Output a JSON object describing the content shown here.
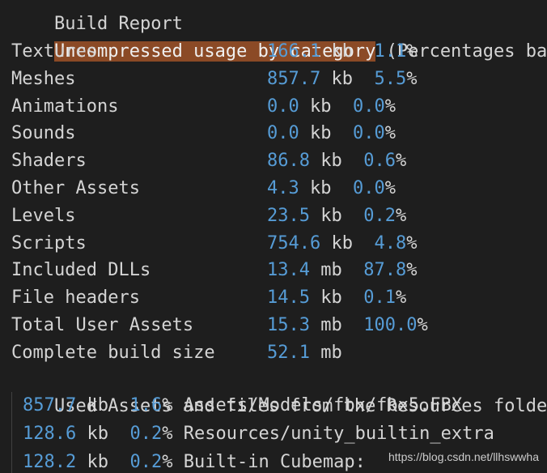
{
  "report": {
    "title_partial": "Build Report",
    "header": {
      "highlighted": "Uncompressed usage by category",
      "rest": " (Percentages based"
    },
    "rows": [
      {
        "label": "Textures",
        "size": "166.1",
        "unit": "kb",
        "pct": "1.1",
        "pct_sign": "%"
      },
      {
        "label": "Meshes",
        "size": "857.7",
        "unit": "kb",
        "pct": "5.5",
        "pct_sign": "%"
      },
      {
        "label": "Animations",
        "size": "0.0",
        "unit": "kb",
        "pct": "0.0",
        "pct_sign": "%"
      },
      {
        "label": "Sounds",
        "size": "0.0",
        "unit": "kb",
        "pct": "0.0",
        "pct_sign": "%"
      },
      {
        "label": "Shaders",
        "size": "86.8",
        "unit": "kb",
        "pct": "0.6",
        "pct_sign": "%"
      },
      {
        "label": "Other Assets",
        "size": "4.3",
        "unit": "kb",
        "pct": "0.0",
        "pct_sign": "%"
      },
      {
        "label": "Levels",
        "size": "23.5",
        "unit": "kb",
        "pct": "0.2",
        "pct_sign": "%"
      },
      {
        "label": "Scripts",
        "size": "754.6",
        "unit": "kb",
        "pct": "4.8",
        "pct_sign": "%"
      },
      {
        "label": "Included DLLs",
        "size": "13.4",
        "unit": "mb",
        "pct": "87.8",
        "pct_sign": "%"
      },
      {
        "label": "File headers",
        "size": "14.5",
        "unit": "kb",
        "pct": "0.1",
        "pct_sign": "%"
      },
      {
        "label": "Total User Assets",
        "size": "15.3",
        "unit": "mb",
        "pct": "100.0",
        "pct_sign": "%"
      },
      {
        "label": "Complete build size",
        "size": "52.1",
        "unit": "mb",
        "pct": "",
        "pct_sign": ""
      }
    ],
    "used_assets_header": "Used Assets and files from the Resources folder,",
    "assets": [
      {
        "size": "857.7",
        "unit": "kb",
        "pct": "1.6",
        "pct_sign": "%",
        "path": "Assets/Models/fbx/fbx5.FBX"
      },
      {
        "size": "128.6",
        "unit": "kb",
        "pct": "0.2",
        "pct_sign": "%",
        "path": "Resources/unity_builtin_extra"
      },
      {
        "size": "128.2",
        "unit": "kb",
        "pct": "0.2",
        "pct_sign": "%",
        "path": "Built-in Cubemap:"
      }
    ]
  },
  "watermark": "https://blog.csdn.net/llhswwha",
  "colors": {
    "background": "#1e1e1e",
    "text": "#d4d4d4",
    "number": "#569cd6",
    "highlight": "#8b4a26"
  }
}
